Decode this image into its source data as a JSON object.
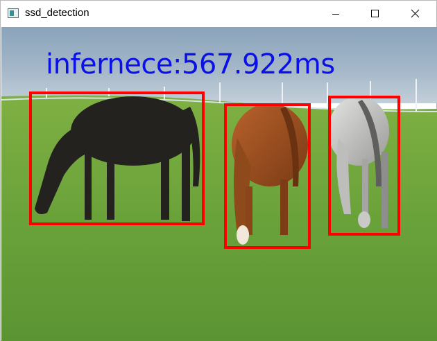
{
  "window": {
    "title": "ssd_detection",
    "controls": {
      "minimize_icon": "minimize-icon",
      "maximize_icon": "maximize-icon",
      "close_icon": "close-icon"
    }
  },
  "overlay": {
    "inference_text": "infernece:567.922ms",
    "text_color": "#0a10e6"
  },
  "detections": {
    "box_color": "#ff0000",
    "count": 3
  },
  "colors": {
    "sky": "#a3b7c8",
    "grass": "#6aa33c"
  }
}
